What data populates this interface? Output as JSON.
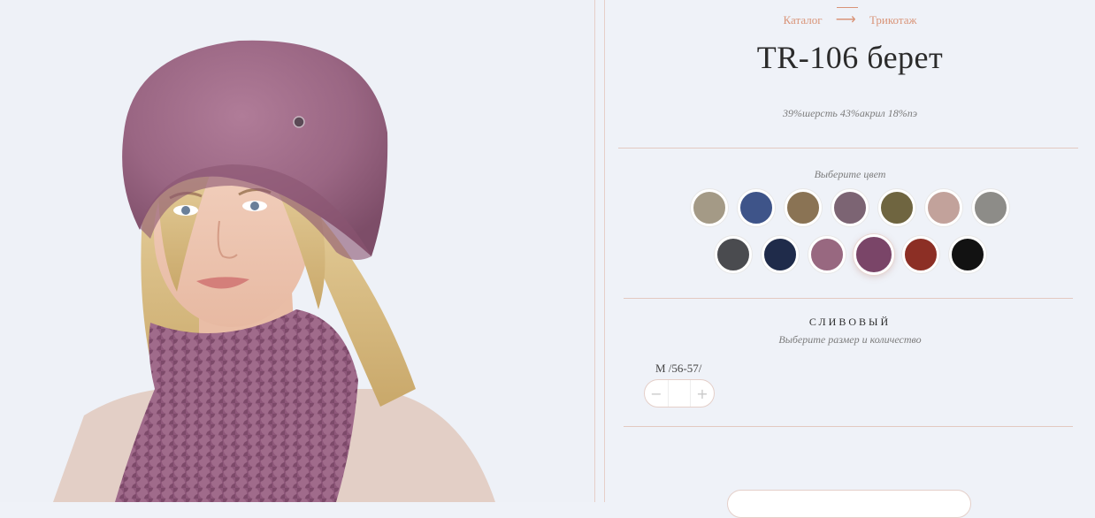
{
  "breadcrumb": {
    "items": [
      "Каталог",
      "Трикотаж"
    ],
    "separator": "⟶"
  },
  "product": {
    "title": "TR-106 берет",
    "composition": "39%шерсть 43%акрил 18%пэ",
    "image_icon": "product-photo-beret-scarf"
  },
  "colors": {
    "prompt": "Выберите цвет",
    "selected_name": "СЛИВОВЫЙ",
    "swatches": [
      {
        "hex": "#a49a86"
      },
      {
        "hex": "#3e5489"
      },
      {
        "hex": "#8a7354"
      },
      {
        "hex": "#7c6473"
      },
      {
        "hex": "#6f6540"
      },
      {
        "hex": "#c2a29b"
      },
      {
        "hex": "#8d8c88"
      },
      {
        "hex": "#4a4b4f"
      },
      {
        "hex": "#1f2b4a"
      },
      {
        "hex": "#986880"
      },
      {
        "hex": "#7a4568",
        "selected": true
      },
      {
        "hex": "#8c2f25"
      },
      {
        "hex": "#121212"
      }
    ]
  },
  "size": {
    "prompt": "Выберите размер и количество",
    "label": "M /56-57/",
    "quantity": "",
    "minus_icon": "minus-icon",
    "plus_icon": "plus-icon",
    "minus": "−",
    "plus": "+"
  },
  "theme": {
    "accent": "#d99478",
    "background": "#eff2f8",
    "divider": "#e3c9c1"
  }
}
